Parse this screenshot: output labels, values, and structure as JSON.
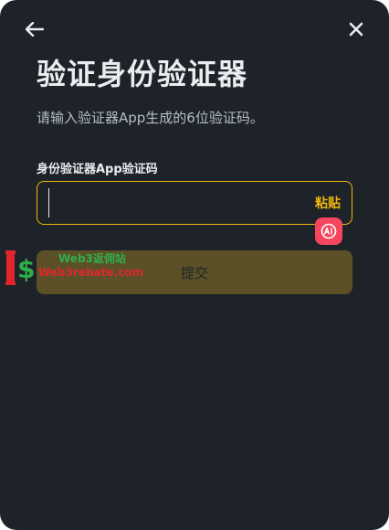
{
  "dialog": {
    "title": "验证身份验证器",
    "subtitle": "请输入验证器App生成的6位验证码。",
    "field_label": "身份验证器App验证码",
    "input_value": "",
    "paste_label": "粘贴",
    "submit_label": "提交"
  },
  "icons": {
    "back": "arrow-left-icon",
    "close": "close-icon",
    "ai_badge": "ai-icon"
  },
  "watermark": {
    "line1": "Web3返佣站",
    "line2": "Web3rebate.com"
  },
  "colors": {
    "background": "#1e2329",
    "accent": "#f0b90b",
    "text_primary": "#eaecef",
    "text_secondary": "#b7bdc6",
    "submit_disabled": "#5b5026",
    "ai_badge": "#f6465d"
  }
}
